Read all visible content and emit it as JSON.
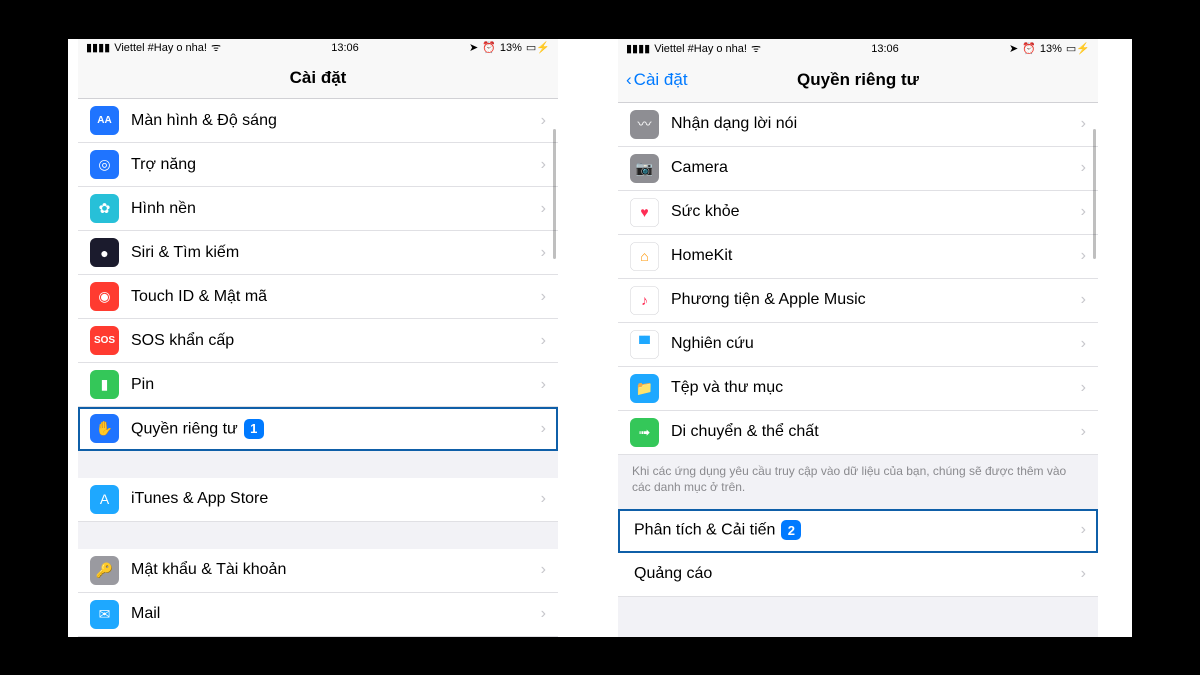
{
  "status": {
    "carrier": "Viettel #Hay o nha!",
    "time": "13:06",
    "battery": "13%"
  },
  "left": {
    "title": "Cài đặt",
    "rows": [
      {
        "label": "Màn hình & Độ sáng",
        "icon": "AA",
        "bg": "#1f74ff"
      },
      {
        "label": "Trợ năng",
        "icon": "◎",
        "bg": "#1f74ff"
      },
      {
        "label": "Hình nền",
        "icon": "✿",
        "bg": "#27c0d8"
      },
      {
        "label": "Siri & Tìm kiếm",
        "icon": "●",
        "bg": "#1b1b2d"
      },
      {
        "label": "Touch ID & Mật mã",
        "icon": "◉",
        "bg": "#ff3b30"
      },
      {
        "label": "SOS khẩn cấp",
        "icon": "SOS",
        "bg": "#ff3b30"
      },
      {
        "label": "Pin",
        "icon": "▮",
        "bg": "#34c759"
      },
      {
        "label": "Quyền riêng tư",
        "icon": "✋",
        "bg": "#1f74ff",
        "badge": "1",
        "highlight": true
      }
    ],
    "rows2": [
      {
        "label": "iTunes & App Store",
        "icon": "A",
        "bg": "#1ea8ff"
      }
    ],
    "rows3": [
      {
        "label": "Mật khẩu & Tài khoản",
        "icon": "🔑",
        "bg": "#9a9aa0"
      },
      {
        "label": "Mail",
        "icon": "✉",
        "bg": "#1ea8ff"
      }
    ]
  },
  "right": {
    "back": "Cài đặt",
    "title": "Quyền riêng tư",
    "rows": [
      {
        "label": "Nhận dạng lời nói",
        "icon": "〰",
        "bg": "#8e8e93"
      },
      {
        "label": "Camera",
        "icon": "📷",
        "bg": "#8e8e93"
      },
      {
        "label": "Sức khỏe",
        "icon": "♥",
        "bg": "#ffffff",
        "fg": "#ff2d55",
        "border": true
      },
      {
        "label": "HomeKit",
        "icon": "⌂",
        "bg": "#ffffff",
        "fg": "#ff9500",
        "border": true
      },
      {
        "label": "Phương tiện & Apple Music",
        "icon": "♪",
        "bg": "#ffffff",
        "fg": "#ff2d55",
        "border": true
      },
      {
        "label": "Nghiên cứu",
        "icon": "▝▘",
        "bg": "#ffffff",
        "fg": "#1ea8ff",
        "border": true
      },
      {
        "label": "Tệp và thư mục",
        "icon": "📁",
        "bg": "#1ea8ff"
      },
      {
        "label": "Di chuyển & thể chất",
        "icon": "➟",
        "bg": "#34c759"
      }
    ],
    "note": "Khi các ứng dụng yêu cầu truy cập vào dữ liệu của bạn, chúng sẽ được thêm vào các danh mục ở trên.",
    "rows2": [
      {
        "label": "Phân tích & Cải tiến",
        "badge": "2",
        "highlight": true
      },
      {
        "label": "Quảng cáo"
      }
    ]
  }
}
